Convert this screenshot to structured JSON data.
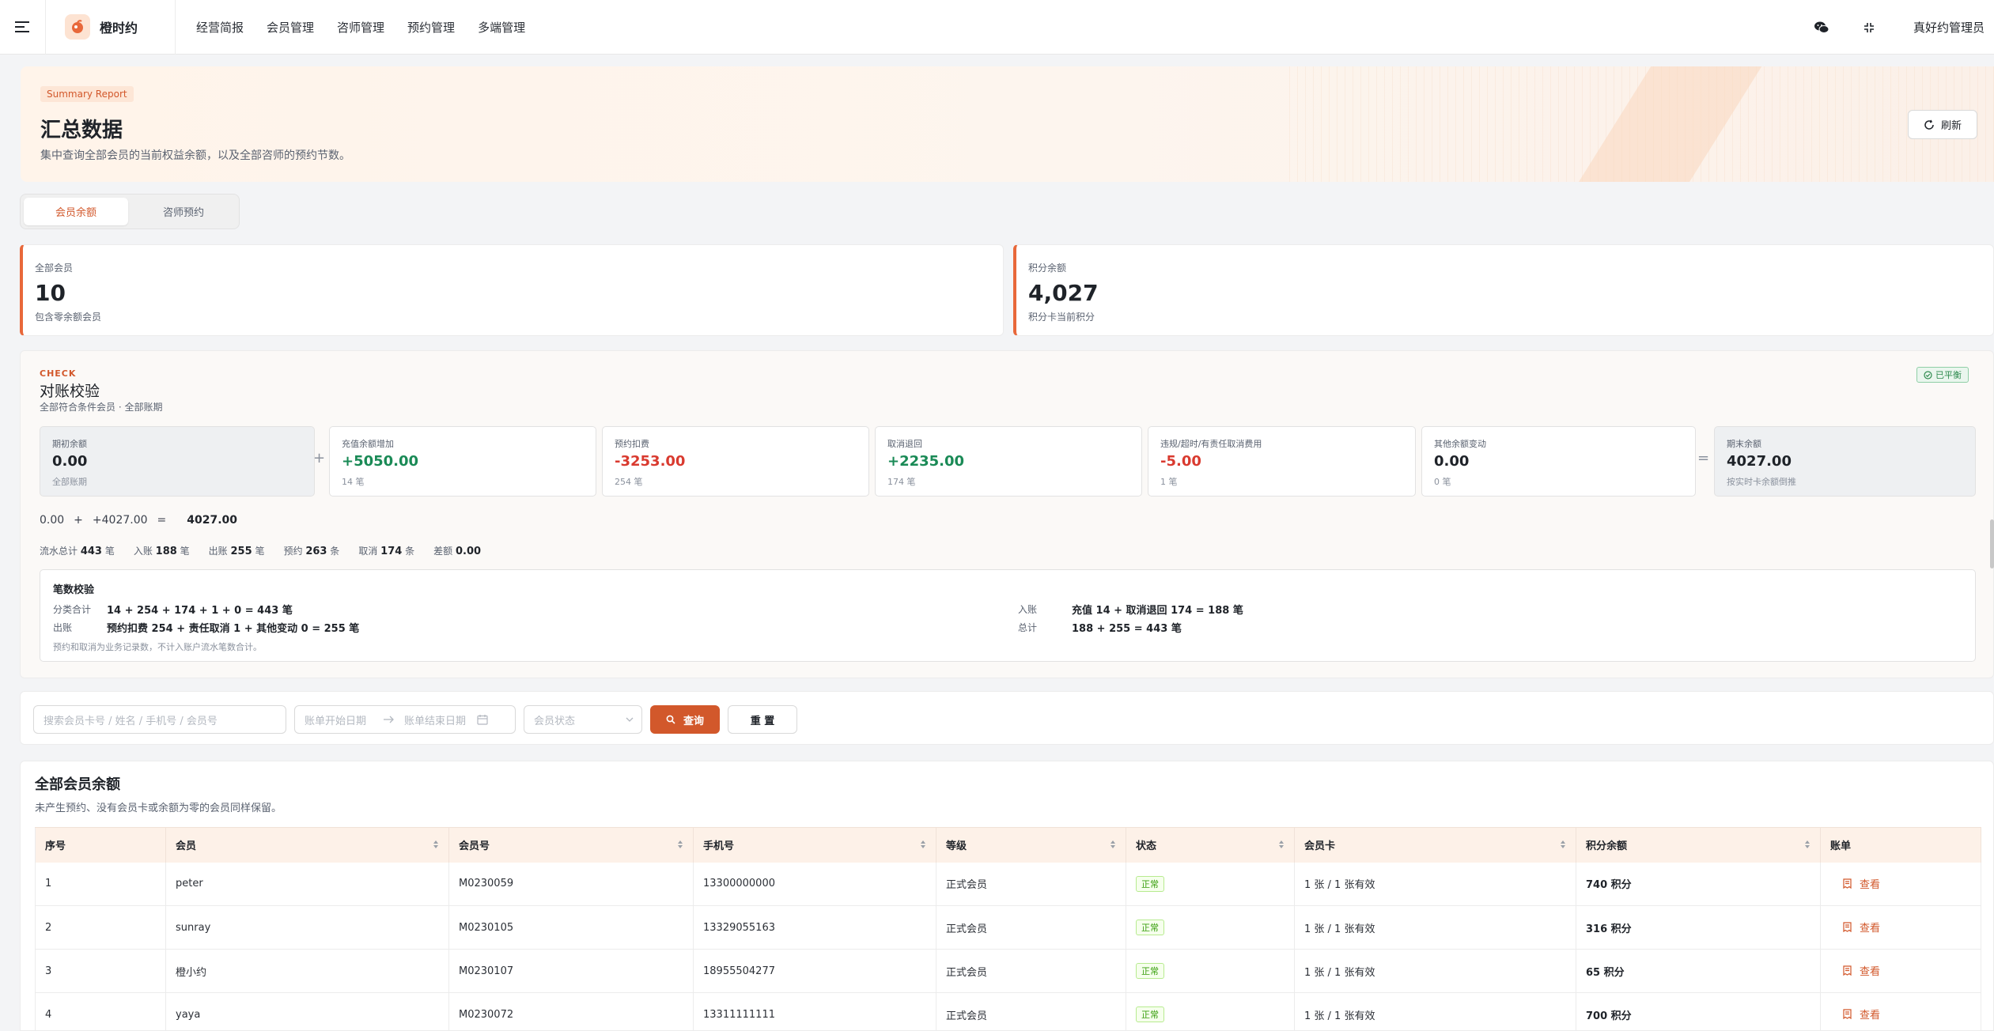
{
  "header": {
    "brand": "橙时约",
    "nav": [
      "经营简报",
      "会员管理",
      "咨师管理",
      "预约管理",
      "多端管理"
    ],
    "admin": "真好约管理员"
  },
  "hero": {
    "tag": "Summary Report",
    "title": "汇总数据",
    "desc": "集中查询全部会员的当前权益余额，以及全部咨师的预约节数。",
    "refresh": "刷新"
  },
  "tabs": [
    "会员余额",
    "咨师预约"
  ],
  "stats": [
    {
      "label": "全部会员",
      "value": "10",
      "sub": "包含零余额会员"
    },
    {
      "label": "积分余额",
      "value": "4,027",
      "sub": "积分卡当前积分"
    }
  ],
  "check": {
    "kicker": "CHECK",
    "title": "对账校验",
    "sub": "全部符合条件会员 · 全部账期",
    "status": "已平衡",
    "boxes": [
      {
        "label": "期初余额",
        "value": "0.00",
        "sub": "全部账期"
      },
      {
        "label": "充值余额增加",
        "value": "+5050.00",
        "sub": "14 笔"
      },
      {
        "label": "预约扣费",
        "value": "-3253.00",
        "sub": "254 笔"
      },
      {
        "label": "取消退回",
        "value": "+2235.00",
        "sub": "174 笔"
      },
      {
        "label": "违规/超时/有责任取消费用",
        "value": "-5.00",
        "sub": "1 笔"
      },
      {
        "label": "其他余额变动",
        "value": "0.00",
        "sub": "0 笔"
      },
      {
        "label": "期末余额",
        "value": "4027.00",
        "sub": "按实时卡余额倒推"
      }
    ],
    "ops": {
      "plus": "+",
      "eq": "="
    },
    "formula": {
      "a": "0.00",
      "plus": "+",
      "b": "+4027.00",
      "eq": "=",
      "result": "4027.00"
    },
    "counts": [
      {
        "label": "流水总计",
        "value": "443",
        "unit": "笔"
      },
      {
        "label": "入账",
        "value": "188",
        "unit": "笔"
      },
      {
        "label": "出账",
        "value": "255",
        "unit": "笔"
      },
      {
        "label": "预约",
        "value": "263",
        "unit": "条"
      },
      {
        "label": "取消",
        "value": "174",
        "unit": "条"
      },
      {
        "label": "差额",
        "value": "0.00",
        "unit": ""
      }
    ],
    "recon": {
      "title": "笔数校验",
      "rows": [
        {
          "k": "分类合计",
          "v": "14 + 254 + 174 + 1 + 0 = 443 笔"
        },
        {
          "k": "出账",
          "v": "预约扣费 254 + 责任取消 1 + 其他变动 0 = 255 笔"
        },
        {
          "k": "入账",
          "v": "充值 14 + 取消退回 174 = 188 笔"
        },
        {
          "k": "总计",
          "v": "188 + 255 = 443 笔"
        }
      ],
      "note": "预约和取消为业务记录数，不计入账户流水笔数合计。"
    }
  },
  "filter": {
    "search_placeholder": "搜索会员卡号 / 姓名 / 手机号 / 会员号",
    "start_placeholder": "账单开始日期",
    "end_placeholder": "账单结束日期",
    "status_placeholder": "会员状态",
    "query": "查询",
    "reset": "重 置"
  },
  "table": {
    "title": "全部会员余额",
    "sub": "未产生预约、没有会员卡或余额为零的会员同样保留。",
    "columns": [
      "序号",
      "会员",
      "会员号",
      "手机号",
      "等级",
      "状态",
      "会员卡",
      "积分余额",
      "账单"
    ],
    "rows": [
      {
        "no": "1",
        "name": "peter",
        "id": "M0230059",
        "phone": "13300000000",
        "level": "正式会员",
        "status": "正常",
        "card": "1 张 / 1 张有效",
        "points": "740 积分",
        "action": "查看"
      },
      {
        "no": "2",
        "name": "sunray",
        "id": "M0230105",
        "phone": "13329055163",
        "level": "正式会员",
        "status": "正常",
        "card": "1 张 / 1 张有效",
        "points": "316 积分",
        "action": "查看"
      },
      {
        "no": "3",
        "name": "橙小约",
        "id": "M0230107",
        "phone": "18955504277",
        "level": "正式会员",
        "status": "正常",
        "card": "1 张 / 1 张有效",
        "points": "65 积分",
        "action": "查看"
      },
      {
        "no": "4",
        "name": "yaya",
        "id": "M0230072",
        "phone": "13311111111",
        "level": "正式会员",
        "status": "正常",
        "card": "1 张 / 1 张有效",
        "points": "700 积分",
        "action": "查看"
      }
    ]
  },
  "colors": {
    "accent": "#d2582b",
    "green": "#1a8a56",
    "red": "#d93a2f",
    "hero_bg": "#fff4ea"
  },
  "icons": [
    "menu-icon",
    "brand-logo-icon",
    "wechat-icon",
    "collapse-icon",
    "refresh-icon",
    "check-circle-icon",
    "search-icon",
    "arrow-right-icon",
    "calendar-icon",
    "chevron-down-icon",
    "sort-icon",
    "bill-icon"
  ]
}
